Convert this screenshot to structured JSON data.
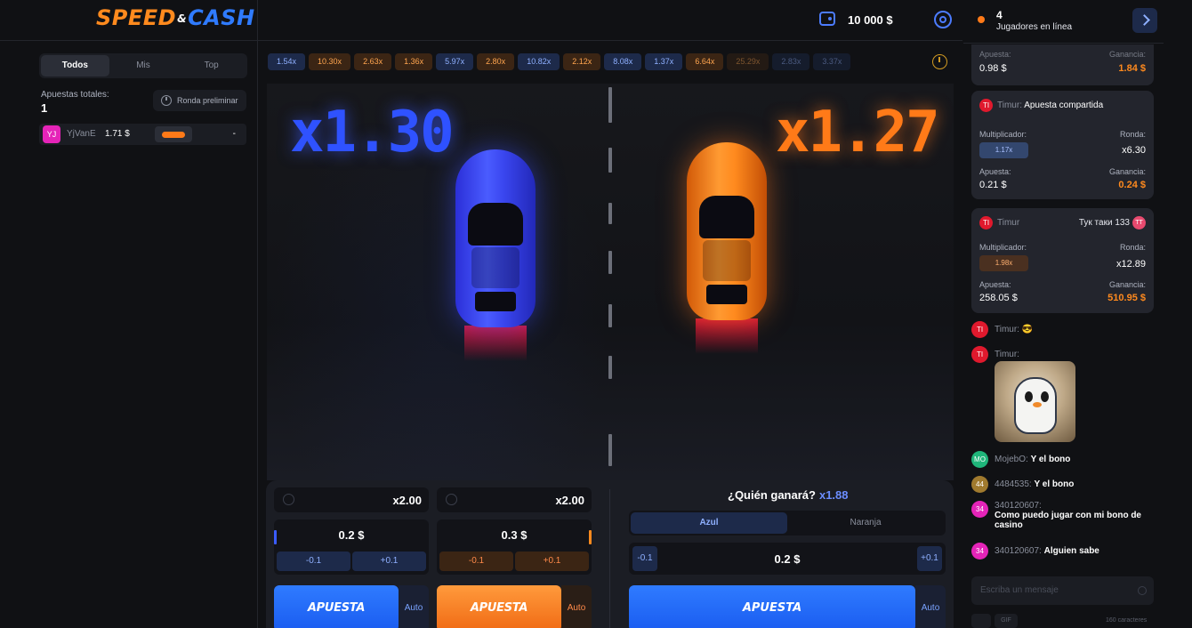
{
  "header": {
    "logo_part1": "SPEED",
    "logo_amp": "&",
    "logo_part2": "CASH",
    "balance": "10 000 $"
  },
  "left": {
    "tabs": [
      {
        "label": "Todos",
        "active": true
      },
      {
        "label": "Mis",
        "active": false
      },
      {
        "label": "Top",
        "active": false
      }
    ],
    "total_label": "Apuestas totales:",
    "total_value": "1",
    "prelim_label": "Ronda preliminar",
    "bets": [
      {
        "avatar": "YJ",
        "user": "YjVanE",
        "amount": "1.71 $",
        "result": "-"
      }
    ]
  },
  "history": [
    {
      "value": "1.54x",
      "color": "blue"
    },
    {
      "value": "10.30x",
      "color": "orange"
    },
    {
      "value": "2.63x",
      "color": "orange"
    },
    {
      "value": "1.36x",
      "color": "orange"
    },
    {
      "value": "5.97x",
      "color": "blue"
    },
    {
      "value": "2.80x",
      "color": "orange"
    },
    {
      "value": "10.82x",
      "color": "blue"
    },
    {
      "value": "2.12x",
      "color": "orange"
    },
    {
      "value": "8.08x",
      "color": "blue"
    },
    {
      "value": "1.37x",
      "color": "blue"
    },
    {
      "value": "6.64x",
      "color": "orange"
    },
    {
      "value": "25.29x",
      "color": "orange"
    },
    {
      "value": "2.83x",
      "color": "blue"
    },
    {
      "value": "3.37x",
      "color": "blue"
    }
  ],
  "race": {
    "blue_mult": "x1.30",
    "orange_mult": "x1.27"
  },
  "controls": {
    "blue_panel": {
      "mult": "x2.00",
      "amount": "0.2 $",
      "dec": "-0.1",
      "inc": "+0.1",
      "bet": "APUESTA",
      "auto": "Auto"
    },
    "orange_panel": {
      "mult": "x2.00",
      "amount": "0.3 $",
      "dec": "-0.1",
      "inc": "+0.1",
      "bet": "APUESTA",
      "auto": "Auto"
    },
    "who_label": "¿Quién ganará?",
    "who_mult": "x1.88",
    "side_tabs": [
      "Azul",
      "Naranja"
    ],
    "side_amount": "0.2 $",
    "side_dec": "-0.1",
    "side_inc": "+0.1",
    "side_bet": "APUESTA",
    "side_auto": "Auto"
  },
  "chat": {
    "online_count": "4",
    "online_label": "Jugadores en línea",
    "card0": {
      "apuesta_label": "Apuesta:",
      "apuesta": "0.98 $",
      "ganancia_label": "Ganancia:",
      "ganancia": "1.84 $"
    },
    "card1": {
      "user": "Timur",
      "title": "Apuesta compartida",
      "mult_label": "Multiplicador:",
      "mult": "1.17x",
      "ronda_label": "Ronda:",
      "ronda": "x6.30",
      "apuesta_label": "Apuesta:",
      "apuesta": "0.21 $",
      "ganancia_label": "Ganancia:",
      "ganancia": "0.24 $"
    },
    "card2": {
      "user": "Timur",
      "shared_user": "Тук таки 133",
      "shared_badge": "TT",
      "mult_label": "Multiplicador:",
      "mult": "1.98x",
      "ronda_label": "Ronda:",
      "ronda": "x12.89",
      "apuesta_label": "Apuesta:",
      "apuesta": "258.05 $",
      "ganancia_label": "Ganancia:",
      "ganancia": "510.95 $"
    },
    "messages": [
      {
        "avatar": "TI",
        "color": "#e0192d",
        "user": "Timur:",
        "text": "😎"
      },
      {
        "avatar": "TI",
        "color": "#e0192d",
        "user": "Timur:",
        "text": ""
      },
      {
        "avatar": "MO",
        "color": "#1fb57a",
        "user": "MojebO:",
        "text": "Y el bono"
      },
      {
        "avatar": "44",
        "color": "#a07a2e",
        "user": "4484535:",
        "text": "Y el bono"
      },
      {
        "avatar": "34",
        "color": "#e524b8",
        "user": "340120607:",
        "text": "Como puedo jugar con mi bono de casino"
      },
      {
        "avatar": "34",
        "color": "#e524b8",
        "user": "340120607:",
        "text": "Alguien sabe"
      }
    ],
    "input_placeholder": "Escriba un mensaje",
    "gif_label": "GIF",
    "char_count": "160 caracteres"
  }
}
